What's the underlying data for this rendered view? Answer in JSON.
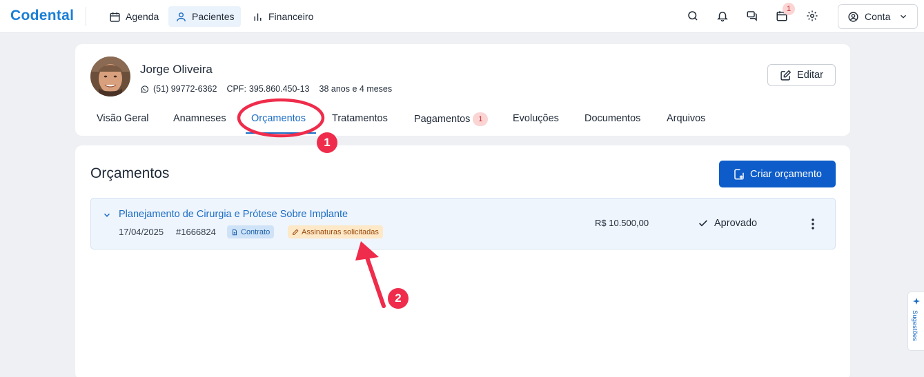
{
  "app": {
    "logo": "Codental"
  },
  "topnav": {
    "items": [
      {
        "label": "Agenda",
        "icon": "calendar-icon",
        "active": false
      },
      {
        "label": "Pacientes",
        "icon": "user-icon",
        "active": true
      },
      {
        "label": "Financeiro",
        "icon": "bar-chart-icon",
        "active": false
      }
    ]
  },
  "toolbar": {
    "icons": [
      "search-icon",
      "bell-icon",
      "chat-icon",
      "calendar-icon",
      "gear-icon"
    ],
    "calendar_badge": "1",
    "account_label": "Conta"
  },
  "patient": {
    "name": "Jorge Oliveira",
    "phone": "(51) 99772-6362",
    "cpf_label": "CPF:",
    "cpf": "395.860.450-13",
    "age": "38 anos e 4 meses",
    "edit_label": "Editar"
  },
  "tabs": [
    {
      "label": "Visão Geral",
      "active": false
    },
    {
      "label": "Anamneses",
      "active": false
    },
    {
      "label": "Orçamentos",
      "active": true
    },
    {
      "label": "Tratamentos",
      "active": false
    },
    {
      "label": "Pagamentos",
      "active": false,
      "badge": "1"
    },
    {
      "label": "Evoluções",
      "active": false
    },
    {
      "label": "Documentos",
      "active": false
    },
    {
      "label": "Arquivos",
      "active": false
    }
  ],
  "budgets": {
    "title": "Orçamentos",
    "create_label": "Criar orçamento",
    "items": [
      {
        "title": "Planejamento de Cirurgia e Prótese Sobre Implante",
        "date": "17/04/2025",
        "id": "#1666824",
        "tags": [
          {
            "label": "Contrato",
            "icon": "document-icon"
          },
          {
            "label": "Assinaturas solicitadas",
            "icon": "pen-icon"
          }
        ],
        "value": "R$ 10.500,00",
        "status": "Aprovado"
      }
    ]
  },
  "annotations": {
    "marker_1": "1",
    "marker_2": "2"
  },
  "side_tab": {
    "label": "Sugestões"
  },
  "colors": {
    "brand": "#1a7fd6",
    "primary": "#0d5cc9",
    "annotation": "#ef2c4b",
    "badge_bg": "#fbd4d4"
  }
}
